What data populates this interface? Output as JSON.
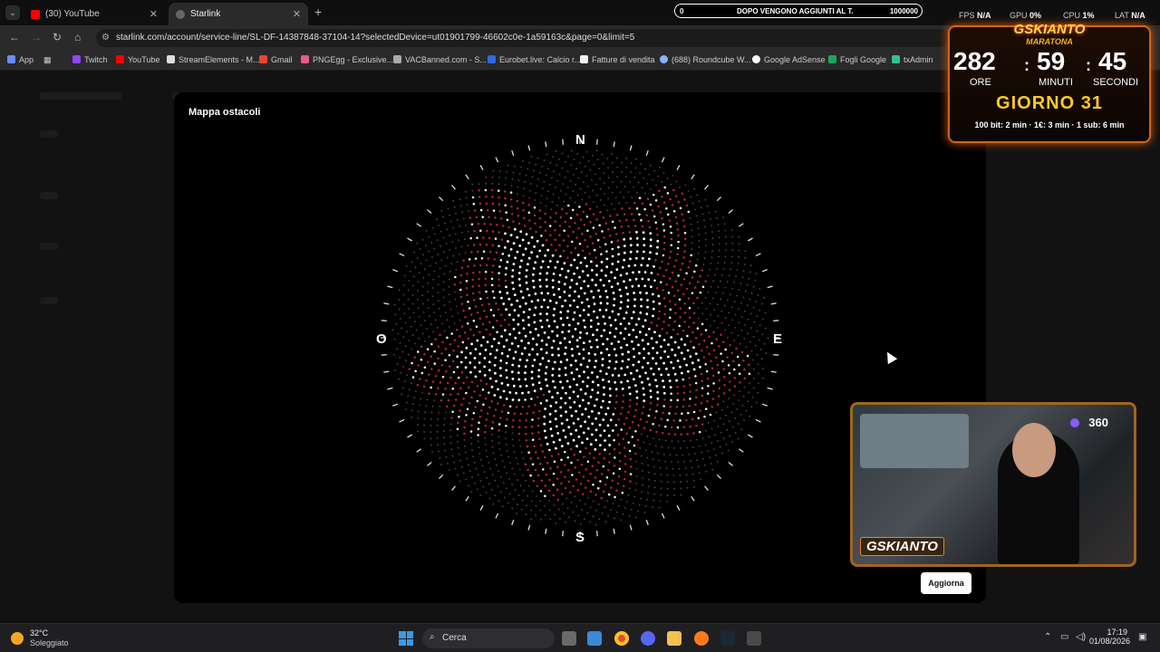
{
  "browser": {
    "tabs": [
      {
        "label": "(30) YouTube",
        "active": false
      },
      {
        "label": "Starlink",
        "active": true
      }
    ],
    "url": "starlink.com/account/service-line/SL-DF-14387848-37104-14?selectedDevice=ut01901799-46602c0e-1a59163c&page=0&limit=5",
    "bookmarks": [
      "App",
      "Twitch",
      "YouTube",
      "StreamElements - M...",
      "Gmail",
      "PNGEgg - Exclusive...",
      "VACBanned.com - S...",
      "Eurobet.live: Calcio r...",
      "Fatture di vendita",
      "(688) Roundcube W...",
      "Google AdSense",
      "Fogli Google",
      "txAdmin"
    ]
  },
  "modal": {
    "title": "Mappa ostacoli",
    "compass": {
      "n": "N",
      "e": "E",
      "s": "S",
      "w": "O"
    },
    "refresh_label": "Aggiorna"
  },
  "overlay": {
    "donation": {
      "start": "0",
      "text": "DOPO VENGONO AGGIUNTI AL T.",
      "goal": "1000000"
    },
    "perf": [
      {
        "label": "FPS",
        "value": "N/A"
      },
      {
        "label": "GPU",
        "value": "0%"
      },
      {
        "label": "CPU",
        "value": "1%"
      },
      {
        "label": "LAT",
        "value": "N/A"
      }
    ],
    "timer": {
      "brand": "GSKIANTO",
      "subtitle": "MARATONA",
      "hours": "282",
      "minutes": "59",
      "seconds": "45",
      "hours_label": "ORE",
      "minutes_label": "MINUTI",
      "seconds_label": "SECONDI",
      "day": "GIORNO 31",
      "rates": "100 bit: 2 min · 1€: 3 min · 1 sub: 6 min"
    },
    "cam": {
      "viewers": "360",
      "logo": "GSKIANTO"
    }
  },
  "taskbar": {
    "temperature": "32°C",
    "weather": "Soleggiato",
    "search_placeholder": "Cerca",
    "time": "17:19",
    "date": "01/08/2026"
  },
  "colors": {
    "obstructed": "#b3262e",
    "clear": "#ffffff",
    "dim": "#4a4a4a"
  }
}
